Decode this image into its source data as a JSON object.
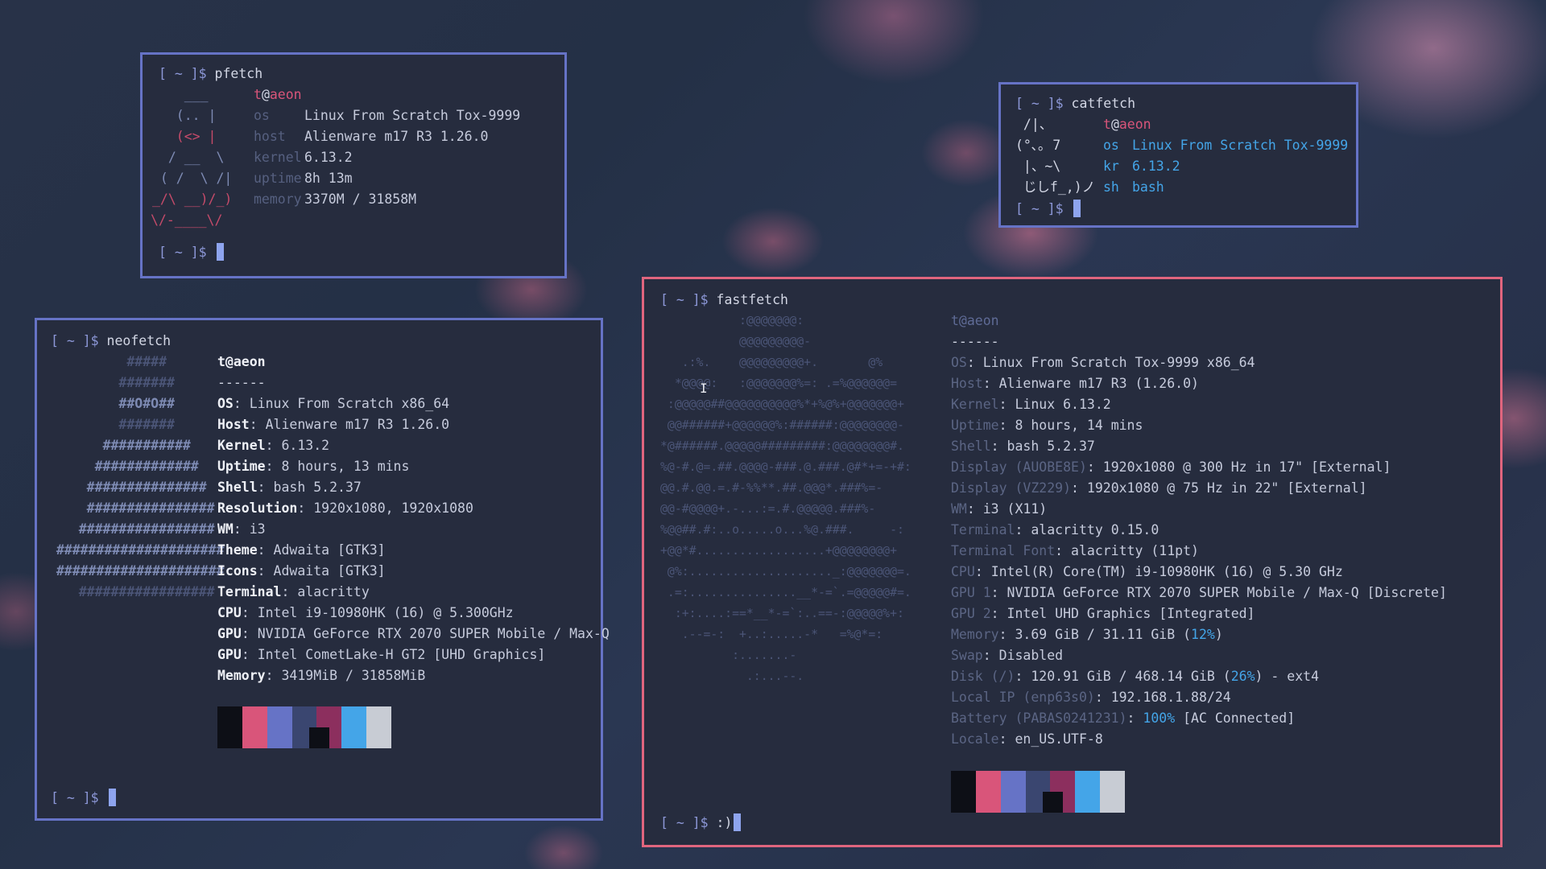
{
  "colors": {
    "blue_border": "#6673c6",
    "pink_border": "#e0657e",
    "accent_pink": "#d9557a",
    "accent_blue": "#44a5e8"
  },
  "prompt": "[ ~ ]$",
  "pfetch": {
    "command": "pfetch",
    "user": "t",
    "at": "@",
    "host": "aeon",
    "art": [
      "    ___",
      "   (.. |",
      "   (<> |",
      "  / __  \\",
      " ( /  \\ /|",
      "_/\\ __)/_)",
      "\\/-____\\/"
    ],
    "keys": [
      "os",
      "host",
      "kernel",
      "uptime",
      "memory"
    ],
    "values": [
      "Linux From Scratch Tox-9999",
      "Alienware m17 R3 1.26.0",
      "6.13.2",
      "8h 13m",
      "3370M / 31858M"
    ]
  },
  "catfetch": {
    "command": "catfetch",
    "user": "t",
    "at": "@",
    "host": "aeon",
    "art": [
      " /|、",
      "(°､｡ 7",
      " |、~\\",
      " じしf_,)ノ"
    ],
    "keys": [
      "os",
      "kr",
      "sh"
    ],
    "values": [
      "Linux From Scratch Tox-9999",
      "6.13.2",
      "bash"
    ]
  },
  "neofetch": {
    "command": "neofetch",
    "title": "t@aeon",
    "separator": "------",
    "art": [
      "          #####",
      "         #######",
      "         ##O#O##",
      "         #######",
      "       ###########",
      "      #############",
      "     ###############",
      "     ################",
      "    #################",
      "  #####################",
      "  #####################",
      "    #################"
    ],
    "keys": [
      "OS",
      "Host",
      "Kernel",
      "Uptime",
      "Shell",
      "Resolution",
      "WM",
      "Theme",
      "Icons",
      "Terminal",
      "CPU",
      "GPU",
      "GPU",
      "Memory"
    ],
    "values": [
      "Linux From Scratch x86_64",
      "Alienware m17 R3 1.26.0",
      "6.13.2",
      "8 hours, 13 mins",
      "bash 5.2.37",
      "1920x1080, 1920x1080",
      "i3",
      "Adwaita [GTK3]",
      "Adwaita [GTK3]",
      "alacritty",
      "Intel i9-10980HK (16) @ 5.300GHz",
      "NVIDIA GeForce RTX 2070 SUPER Mobile / Max-Q",
      "Intel CometLake-H GT2 [UHD Graphics]",
      "3419MiB / 31858MiB"
    ],
    "palette": [
      "#0d0f16",
      "#d9557a",
      "#6673c6",
      "#3a4670",
      "#8c2f5e",
      "#44a5e8",
      "#c8ccd4"
    ]
  },
  "fastfetch": {
    "command": "fastfetch",
    "title": "t@aeon",
    "separator": "------",
    "art": [
      "           :@@@@@@@:",
      "           @@@@@@@@@-",
      "   .:%.    @@@@@@@@@+.       @%",
      "  *@@@@:   :@@@@@@@%=: .=%@@@@@@=",
      " :@@@@@##@@@@@@@@@@%*+%@%+@@@@@@@+",
      " @@######+@@@@@@%:######:@@@@@@@@-",
      "*@######.@@@@@#########:@@@@@@@@#.",
      "%@-#.@=.##.@@@@-###.@.###.@#*+=-+#:",
      "@@.#.@@.=.#-%%**.##.@@@*.###%=-",
      "@@-#@@@@+.-...:=.#.@@@@@.###%-",
      "%@@##.#:..o.....o...%@.###.     -:",
      "+@@*#..................+@@@@@@@@+",
      " @%:...................._:@@@@@@@=.",
      " .=:...............__*-=`.=@@@@@#=.",
      "  :+:....:==*__*-=`:..==-:@@@@@%+:",
      "   .--=-:  +..:.....-*   =%@*=:",
      "          :.......-",
      "            .:...--."
    ],
    "keys": [
      "OS",
      "Host",
      "Kernel",
      "Uptime",
      "Shell",
      "Display (AUOBE8E)",
      "Display (VZ229)",
      "WM",
      "Terminal",
      "Terminal Font",
      "CPU",
      "GPU 1",
      "GPU 2",
      "Memory",
      "Swap",
      "Disk (/)",
      "Local IP (enp63s0)",
      "Battery (PABAS0241231)",
      "Locale"
    ],
    "values": [
      "Linux From Scratch Tox-9999 x86_64",
      "Alienware m17 R3 (1.26.0)",
      "Linux 6.13.2",
      "8 hours, 14 mins",
      "bash 5.2.37",
      "1920x1080 @ 300 Hz in 17\" [External]",
      "1920x1080 @ 75 Hz in 22\" [External]",
      "i3 (X11)",
      "alacritty 0.15.0",
      "alacritty (11pt)",
      "Intel(R) Core(TM) i9-10980HK (16) @ 5.30 GHz",
      "NVIDIA GeForce RTX 2070 SUPER Mobile / Max-Q [Discrete]",
      "Intel UHD Graphics [Integrated]",
      "3.69 GiB / 31.11 GiB",
      "Disabled",
      "120.91 GiB / 468.14 GiB",
      "192.168.1.88/24",
      "",
      "en_US.UTF-8"
    ],
    "memory_pct": "12%",
    "disk_pct": "26%",
    "disk_fs": " - ext4",
    "battery_pct": "100%",
    "battery_state": " [AC Connected]",
    "last_prompt_input": ":)",
    "palette": [
      "#0d0f16",
      "#d9557a",
      "#6673c6",
      "#3a4670",
      "#8c2f5e",
      "#44a5e8",
      "#c8ccd4"
    ]
  }
}
